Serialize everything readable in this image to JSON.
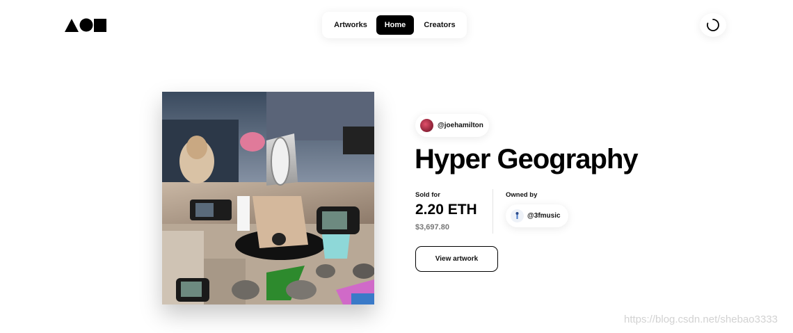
{
  "logo": {
    "icon": "aoh-shapes-logo"
  },
  "nav": {
    "items": [
      {
        "label": "Artworks",
        "active": false
      },
      {
        "label": "Home",
        "active": true
      },
      {
        "label": "Creators",
        "active": false
      }
    ]
  },
  "header": {
    "loader_icon": "loading-spinner-icon"
  },
  "artwork": {
    "image": "hyper-geography-collage"
  },
  "creator": {
    "handle": "@joehamilton"
  },
  "title": "Hyper Geography",
  "sale": {
    "sold_label": "Sold for",
    "eth_value": "2.20 ETH",
    "usd_value": "$3,697.80"
  },
  "owner": {
    "label": "Owned by",
    "handle": "@3fmusic"
  },
  "actions": {
    "view_label": "View artwork"
  },
  "watermark": "https://blog.csdn.net/shebao3333",
  "colors": {
    "accent": "#000000",
    "muted": "#777777",
    "background": "#ffffff"
  }
}
